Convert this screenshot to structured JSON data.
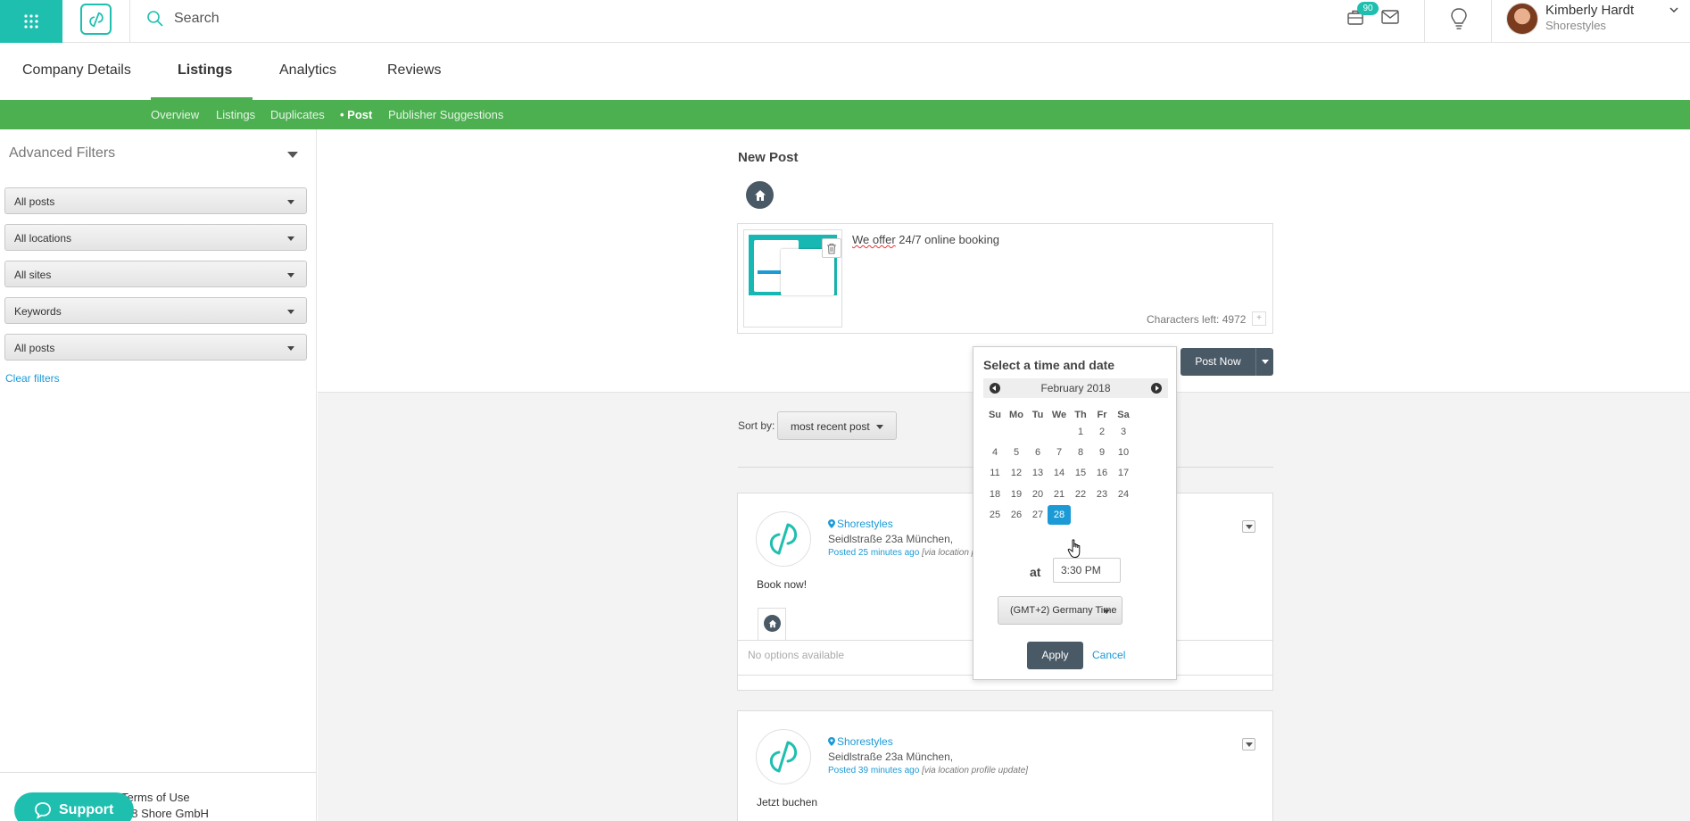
{
  "topbar": {
    "search_placeholder": "Search",
    "notification_count": "90",
    "user_name": "Kimberly Hardt",
    "user_company": "Shorestyles"
  },
  "tabs": [
    {
      "label": "Company Details"
    },
    {
      "label": "Listings"
    },
    {
      "label": "Analytics"
    },
    {
      "label": "Reviews"
    }
  ],
  "subnav": [
    {
      "label": "Overview"
    },
    {
      "label": "Listings"
    },
    {
      "label": "Duplicates"
    },
    {
      "label": "• Post"
    },
    {
      "label": "Publisher Suggestions"
    }
  ],
  "sidebar": {
    "title": "Advanced Filters",
    "filters": [
      "All posts",
      "All locations",
      "All sites",
      "Keywords",
      "All posts"
    ],
    "clear_filters": "Clear filters",
    "terms": "Terms of Use",
    "copyright": "18 Shore GmbH",
    "support": "Support"
  },
  "composer": {
    "title": "New Post",
    "text_prefix": "We offer",
    "text_rest": " 24/7 online booking",
    "chars_left": "Characters left: 4972",
    "post_now": "Post Now"
  },
  "sort": {
    "label": "Sort by:",
    "value": "most recent post"
  },
  "posts": [
    {
      "name": "Shorestyles",
      "address": "Seidlstraße 23a München,",
      "posted": "Posted 25 minutes ago",
      "via": "[via location pr",
      "body": "Book now!",
      "options": "No options available"
    },
    {
      "name": "Shorestyles",
      "address": "Seidlstraße 23a München,",
      "posted": "Posted 39 minutes ago",
      "via": "[via location profile update]",
      "body": "Jetzt buchen"
    }
  ],
  "picker": {
    "title": "Select a time and date",
    "month": "February 2018",
    "weekdays": [
      "Su",
      "Mo",
      "Tu",
      "We",
      "Th",
      "Fr",
      "Sa"
    ],
    "days": [
      "1",
      "2",
      "3",
      "4",
      "5",
      "6",
      "7",
      "8",
      "9",
      "10",
      "11",
      "12",
      "13",
      "14",
      "15",
      "16",
      "17",
      "18",
      "19",
      "20",
      "21",
      "22",
      "23",
      "24",
      "25",
      "26",
      "27",
      "28"
    ],
    "first_weekday_index": 4,
    "selected_day": "28",
    "at_label": "at",
    "time": "3:30 PM",
    "timezone": "(GMT+2) Germany Time",
    "apply": "Apply",
    "cancel": "Cancel"
  },
  "colors": {
    "brand_teal": "#1fbfb0",
    "nav_green": "#4caf50",
    "link_blue": "#1b9ad6",
    "button_dark": "#4a5966"
  }
}
